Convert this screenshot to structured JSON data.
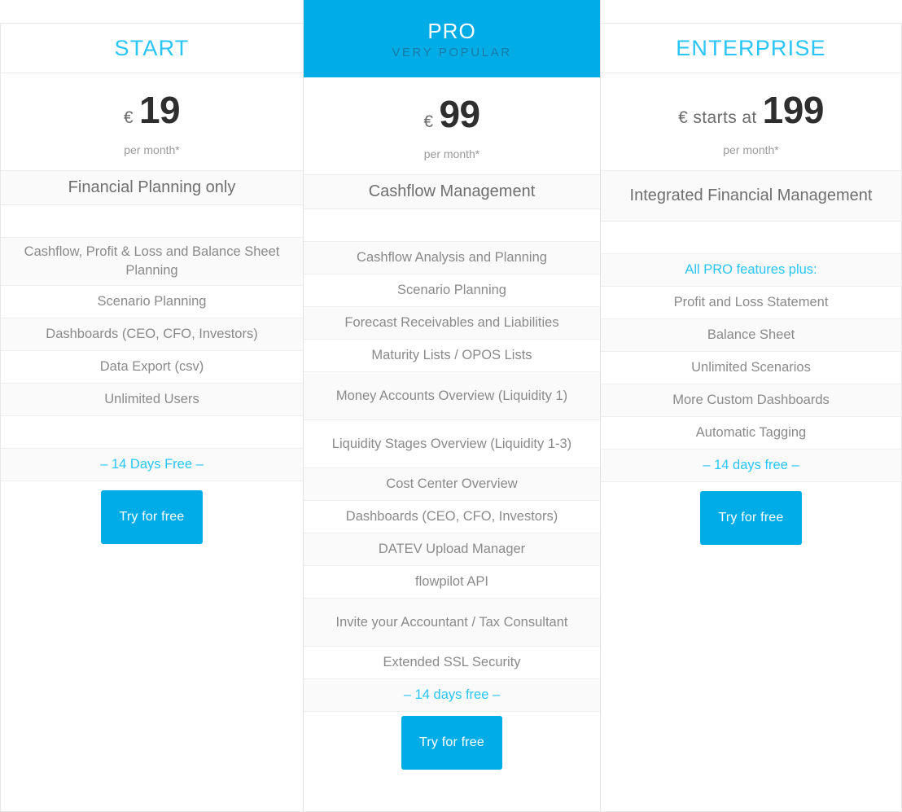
{
  "theme": {
    "accent": "#00ace6",
    "accent_text": "#29c5f6",
    "tagline_color": "#1a7ba8",
    "row_alt_bg": "#fafafa",
    "text_muted": "#8a8a8a"
  },
  "plans": [
    {
      "id": "start",
      "name": "START",
      "tagline": "",
      "price_prefix": "€",
      "price_amount": "19",
      "price_period": "per month*",
      "subtitle": "Financial Planning only",
      "features": [
        {
          "label": "",
          "type": "spacer"
        },
        {
          "label": "Cashflow, Profit & Loss and Balance Sheet Planning",
          "type": "two-line"
        },
        {
          "label": "Scenario Planning",
          "type": "normal"
        },
        {
          "label": "Dashboards (CEO, CFO, Investors)",
          "type": "normal"
        },
        {
          "label": "Data Export (csv)",
          "type": "normal"
        },
        {
          "label": "Unlimited Users",
          "type": "normal"
        },
        {
          "label": "",
          "type": "spacer"
        },
        {
          "label": "– 14 Days Free –",
          "type": "highlight"
        }
      ],
      "cta_label": "Try for free"
    },
    {
      "id": "pro",
      "name": "PRO",
      "tagline": "VERY POPULAR",
      "price_prefix": "€",
      "price_amount": "99",
      "price_period": "per month*",
      "subtitle": "Cashflow Management",
      "features": [
        {
          "label": "",
          "type": "spacer"
        },
        {
          "label": "Cashflow Analysis and Planning",
          "type": "normal"
        },
        {
          "label": "Scenario Planning",
          "type": "normal"
        },
        {
          "label": "Forecast Receivables and Liabilities",
          "type": "normal"
        },
        {
          "label": "Maturity Lists / OPOS Lists",
          "type": "normal"
        },
        {
          "label": "Money Accounts Overview (Liquidity 1)",
          "type": "two-line"
        },
        {
          "label": "Liquidity Stages Overview (Liquidity 1-3)",
          "type": "two-line"
        },
        {
          "label": "Cost Center Overview",
          "type": "normal"
        },
        {
          "label": "Dashboards (CEO, CFO, Investors)",
          "type": "normal"
        },
        {
          "label": "DATEV Upload Manager",
          "type": "normal"
        },
        {
          "label": "flowpilot API",
          "type": "normal"
        },
        {
          "label": "Invite your Accountant / Tax Consultant",
          "type": "two-line"
        },
        {
          "label": "Extended SSL Security",
          "type": "normal"
        },
        {
          "label": "– 14 days free –",
          "type": "highlight"
        }
      ],
      "cta_label": "Try for free"
    },
    {
      "id": "enterprise",
      "name": "ENTERPRISE",
      "tagline": "",
      "price_prefix": "€ starts at",
      "price_amount": "199",
      "price_period": "per month*",
      "subtitle": "Integrated Financial Management",
      "features": [
        {
          "label": "",
          "type": "spacer"
        },
        {
          "label": "All PRO features plus:",
          "type": "highlight"
        },
        {
          "label": "Profit and Loss Statement",
          "type": "normal"
        },
        {
          "label": "Balance Sheet",
          "type": "normal"
        },
        {
          "label": "Unlimited Scenarios",
          "type": "normal"
        },
        {
          "label": "More Custom Dashboards",
          "type": "normal"
        },
        {
          "label": "Automatic Tagging",
          "type": "normal"
        },
        {
          "label": "– 14 days free –",
          "type": "highlight"
        }
      ],
      "cta_label": "Try for free"
    }
  ]
}
